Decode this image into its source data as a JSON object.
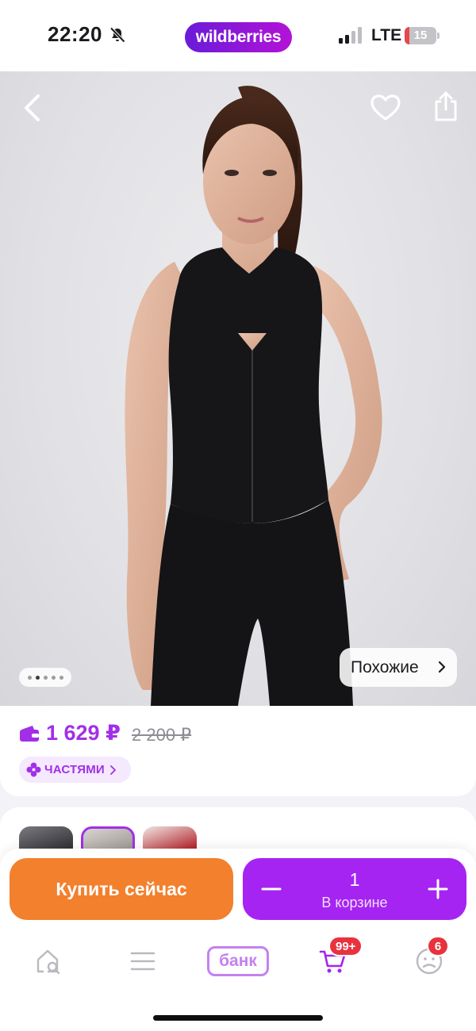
{
  "status_bar": {
    "time": "22:20",
    "brand": "wildberries",
    "network": "LTE",
    "battery_level": "15",
    "battery_fraction": 0.15
  },
  "hero": {
    "back_icon": "chevron-left-icon",
    "favorite_icon": "heart-icon",
    "share_icon": "share-icon",
    "similar_label": "Похожие",
    "gallery_total": 5,
    "gallery_active_index": 1
  },
  "price": {
    "current": "1 629 ₽",
    "old": "2 200 ₽",
    "installments_label": "ЧАСТЯМИ"
  },
  "actions": {
    "buy_now_label": "Купить сейчас",
    "cart_quantity": "1",
    "cart_label": "В корзине"
  },
  "tabbar": {
    "bank_label": "банк",
    "cart_badge": "99+",
    "profile_badge": "6"
  },
  "colors": {
    "brand_purple": "#a524f2",
    "buy_orange": "#f2802d",
    "badge_red": "#e8333f",
    "price_purple": "#a22fe8"
  }
}
